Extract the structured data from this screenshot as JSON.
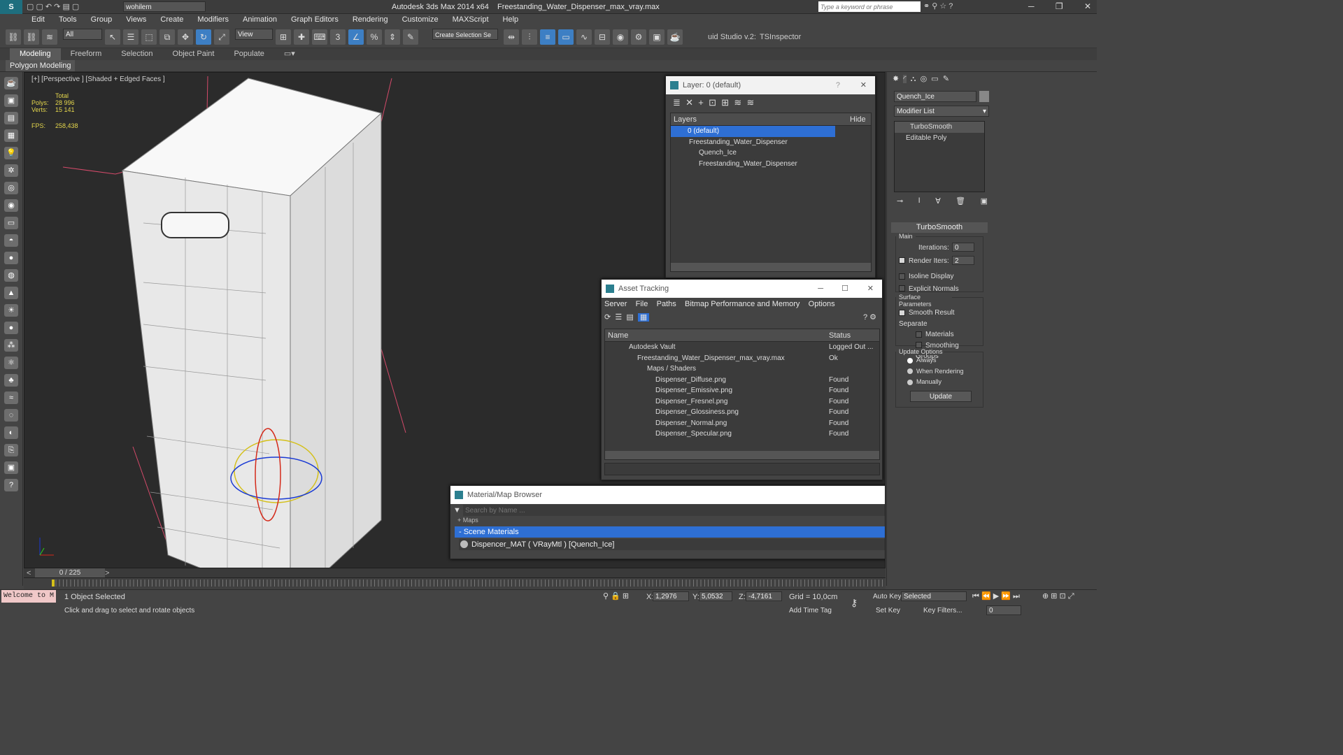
{
  "window": {
    "app_title": "Autodesk 3ds Max  2014 x64",
    "file": "Freestanding_Water_Dispenser_max_vray.max",
    "workspace": "wohilem",
    "search_placeholder": "Type a keyword or phrase"
  },
  "menu": [
    "Edit",
    "Tools",
    "Group",
    "Views",
    "Create",
    "Modifiers",
    "Animation",
    "Graph Editors",
    "Rendering",
    "Customize",
    "MAXScript",
    "Help"
  ],
  "toolbar": {
    "selection_filter": "All",
    "ref_coord": "View",
    "named_selection": "Create Selection Se",
    "studio": "uid Studio v.2:",
    "tsinspector": "TSInspector"
  },
  "ribbon": {
    "tabs": [
      "Modeling",
      "Freeform",
      "Selection",
      "Object Paint",
      "Populate"
    ],
    "sub": "Polygon Modeling"
  },
  "viewport": {
    "label": "[+] [Perspective ] [Shaded + Edged Faces ]",
    "total": "Total",
    "polys_label": "Polys:",
    "polys": "28 996",
    "verts_label": "Verts:",
    "verts": "15 141",
    "fps_label": "FPS:",
    "fps": "258,438"
  },
  "layer_panel": {
    "title": "Layer: 0 (default)",
    "col_layers": "Layers",
    "col_hide": "Hide",
    "rows": [
      "0 (default)",
      "Freestanding_Water_Dispenser",
      "Quench_Ice",
      "Freestanding_Water_Dispenser"
    ]
  },
  "asset_panel": {
    "title": "Asset Tracking",
    "menu": [
      "Server",
      "File",
      "Paths",
      "Bitmap Performance and Memory",
      "Options"
    ],
    "col_name": "Name",
    "col_status": "Status",
    "rows": [
      {
        "name": "Autodesk Vault",
        "status": "Logged Out ..."
      },
      {
        "name": "Freestanding_Water_Dispenser_max_vray.max",
        "status": "Ok"
      },
      {
        "name": "Maps / Shaders",
        "status": ""
      },
      {
        "name": "Dispenser_Diffuse.png",
        "status": "Found"
      },
      {
        "name": "Dispenser_Emissive.png",
        "status": "Found"
      },
      {
        "name": "Dispenser_Fresnel.png",
        "status": "Found"
      },
      {
        "name": "Dispenser_Glossiness.png",
        "status": "Found"
      },
      {
        "name": "Dispenser_Normal.png",
        "status": "Found"
      },
      {
        "name": "Dispenser_Specular.png",
        "status": "Found"
      }
    ]
  },
  "material_panel": {
    "title": "Material/Map Browser",
    "search_placeholder": "Search by Name ...",
    "maps_label": "+ Maps",
    "group": "- Scene Materials",
    "item": "Dispencer_MAT  ( VRayMtl )  [Quench_Ice]"
  },
  "command_panel": {
    "object_name": "Quench_Ice",
    "modifier_list": "Modifier List",
    "stack": [
      "TurboSmooth",
      "Editable Poly"
    ],
    "rollout": "TurboSmooth",
    "main": "Main",
    "iterations_label": "Iterations:",
    "iterations": "0",
    "render_iters_label": "Render Iters:",
    "render_iters": "2",
    "isoline": "Isoline Display",
    "explicit": "Explicit Normals",
    "surface": "Surface Parameters",
    "smooth": "Smooth Result",
    "separate": "Separate",
    "materials": "Materials",
    "smoothing": "Smoothing Groups",
    "update_options": "Update Options",
    "always": "Always",
    "when_rendering": "When Rendering",
    "manually": "Manually",
    "update_btn": "Update"
  },
  "timeline": {
    "frame": "0 / 225"
  },
  "status": {
    "welcome": "Welcome to M",
    "selected": "1 Object Selected",
    "hint": "Click and drag to select and rotate objects",
    "x_label": "X:",
    "x": "1,2976",
    "y_label": "Y:",
    "y": "5,0532",
    "z_label": "Z:",
    "z": "-4,7161",
    "grid": "Grid = 10,0cm",
    "add_time_tag": "Add Time Tag",
    "auto_key": "Auto Key",
    "set_key": "Set Key",
    "selected_dd": "Selected",
    "key_filters": "Key Filters...",
    "frame_field": "0"
  }
}
